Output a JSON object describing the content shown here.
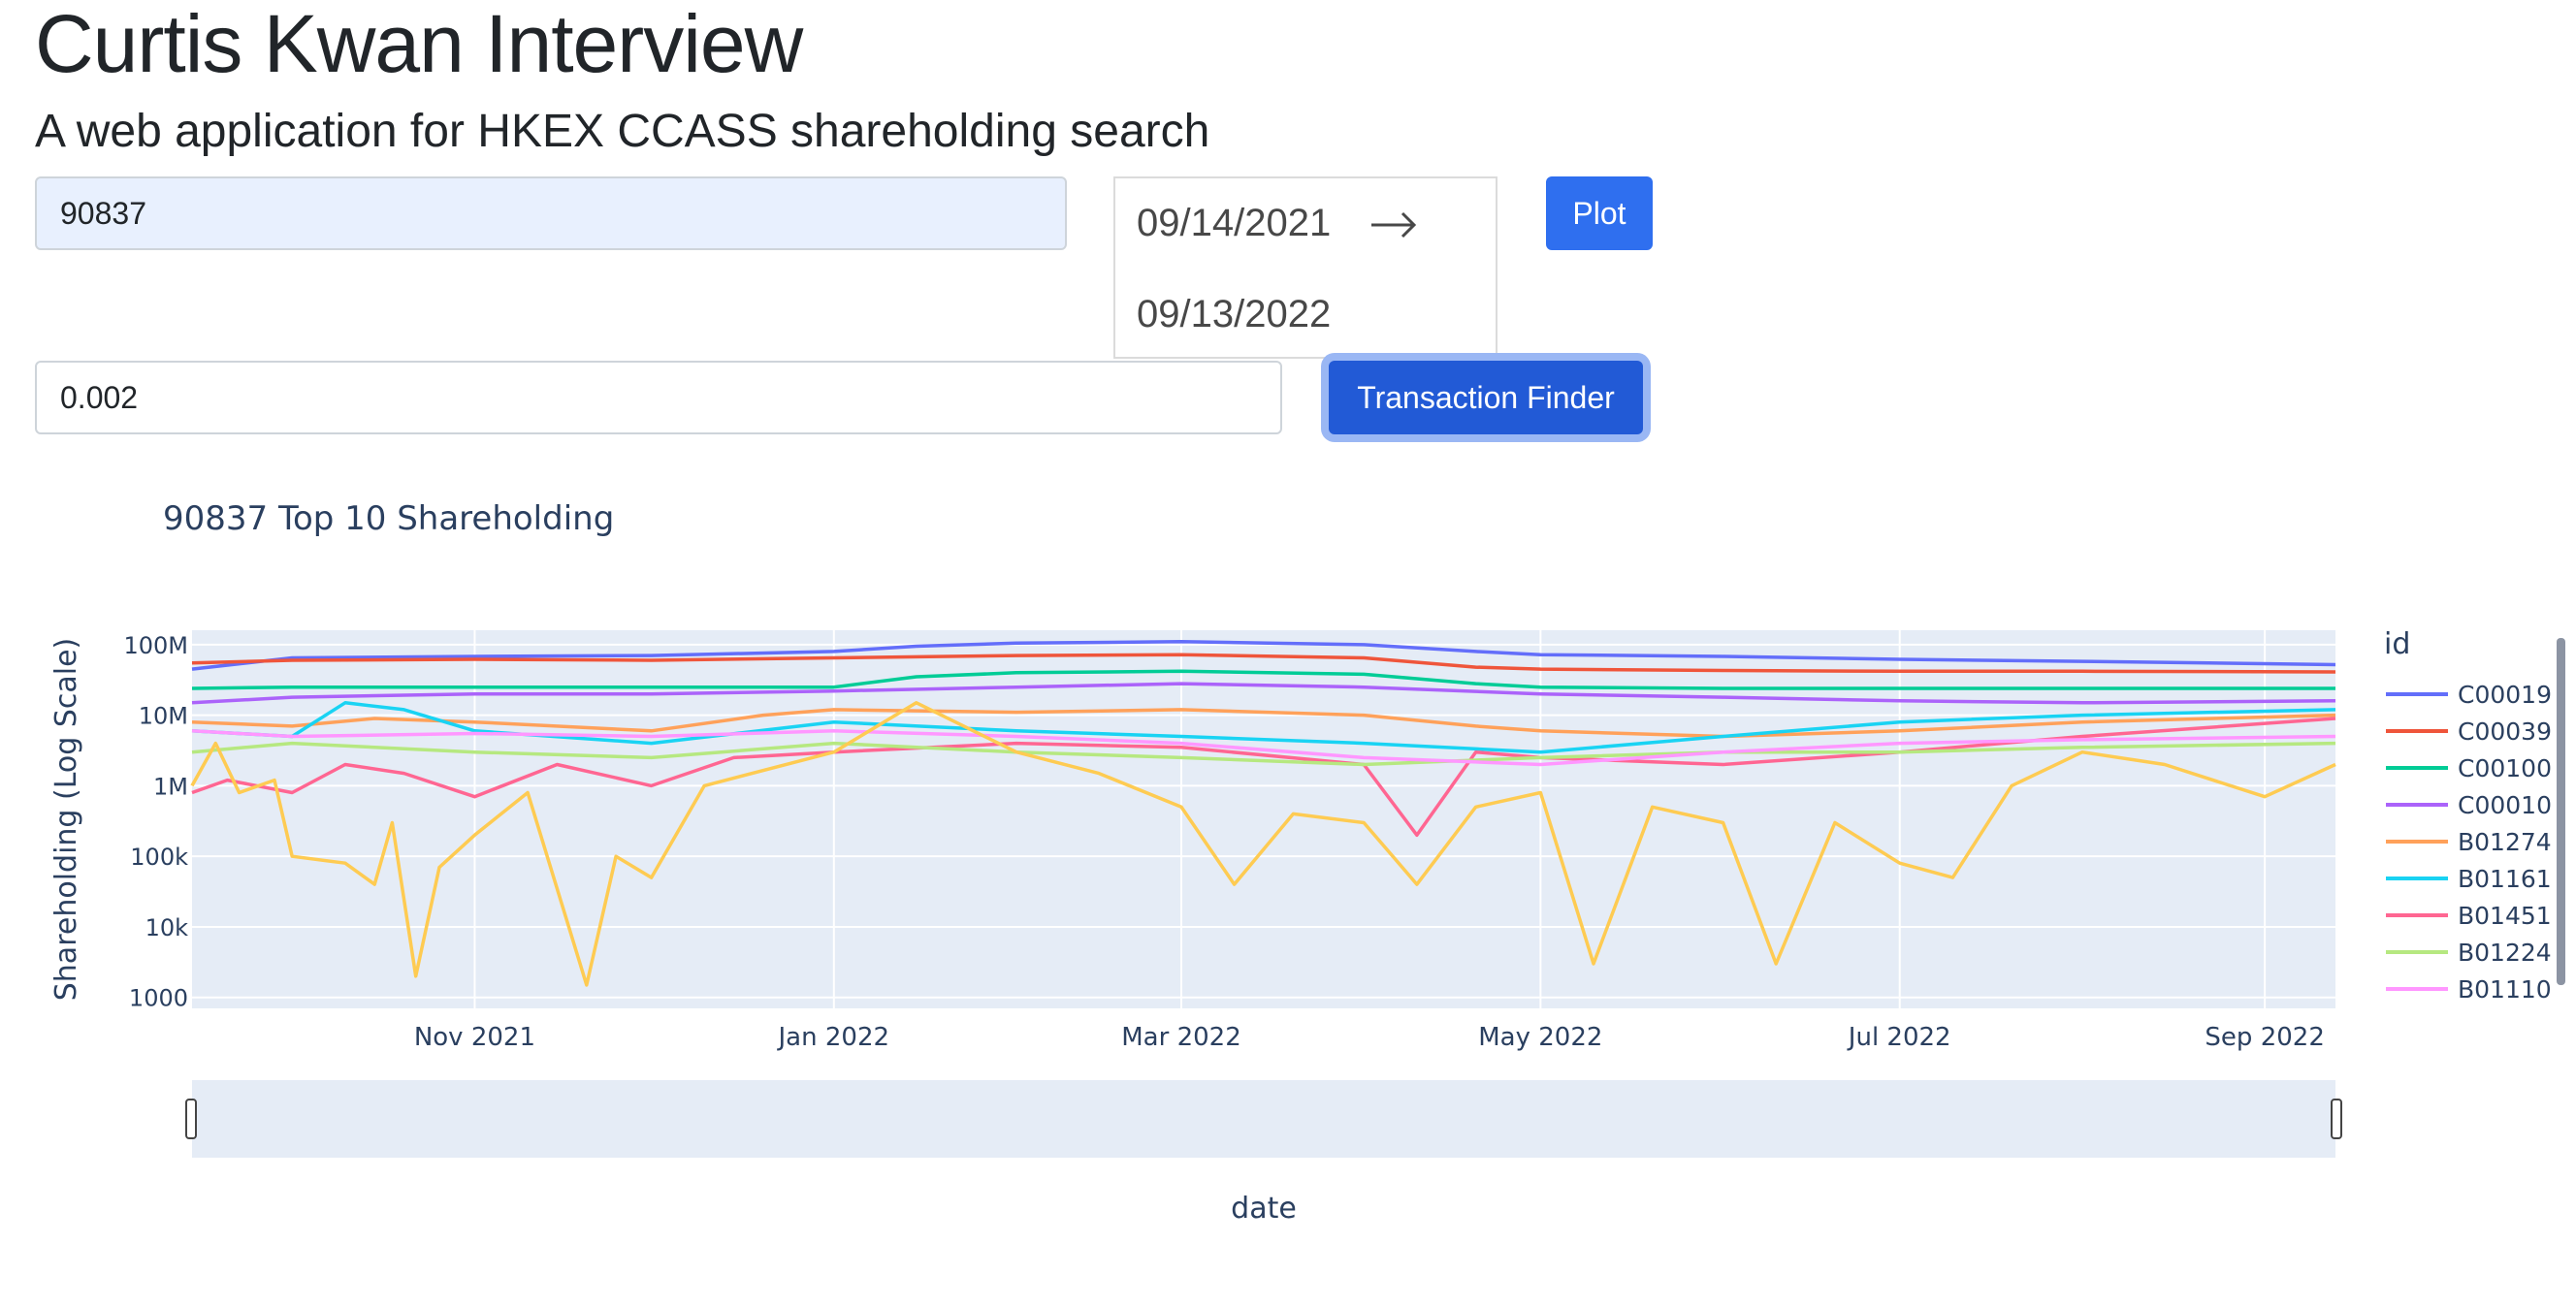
{
  "page": {
    "title": "Curtis Kwan Interview",
    "subtitle": "A web application for HKEX CCASS shareholding search"
  },
  "form": {
    "stock_code_value": "90837",
    "date_start": "09/14/2021",
    "date_end": "09/13/2022",
    "plot_label": "Plot",
    "threshold_value": "0.002",
    "finder_label": "Transaction Finder"
  },
  "icons": {
    "date_arrow": "right-arrow-icon"
  },
  "chart_data": {
    "type": "line",
    "title": "90837 Top 10 Shareholding",
    "xlabel": "date",
    "ylabel": "Shareholding (Log Scale)",
    "y_scale": "log",
    "ylim": [
      700,
      160000000
    ],
    "xlim": [
      "2021-09-14",
      "2022-09-13"
    ],
    "x_ticks": [
      "Nov 2021",
      "Jan 2022",
      "Mar 2022",
      "May 2022",
      "Jul 2022",
      "Sep 2022"
    ],
    "y_ticks": [
      "100M",
      "10M",
      "1M",
      "100k",
      "10k",
      "1000"
    ],
    "legend_title": "id",
    "legend_position": "right",
    "grid": true,
    "range_slider": true,
    "series": [
      {
        "name": "C00019",
        "color": "#636efa",
        "values": [
          [
            "2021-09-14",
            45000000
          ],
          [
            "2021-10-01",
            65000000
          ],
          [
            "2021-11-01",
            68000000
          ],
          [
            "2021-12-01",
            70000000
          ],
          [
            "2022-01-01",
            80000000
          ],
          [
            "2022-01-15",
            95000000
          ],
          [
            "2022-02-01",
            105000000
          ],
          [
            "2022-03-01",
            110000000
          ],
          [
            "2022-04-01",
            100000000
          ],
          [
            "2022-04-20",
            80000000
          ],
          [
            "2022-05-01",
            72000000
          ],
          [
            "2022-06-01",
            68000000
          ],
          [
            "2022-07-01",
            62000000
          ],
          [
            "2022-08-01",
            58000000
          ],
          [
            "2022-09-13",
            52000000
          ]
        ]
      },
      {
        "name": "C00039",
        "color": "#ef553b",
        "values": [
          [
            "2021-09-14",
            55000000
          ],
          [
            "2021-10-01",
            60000000
          ],
          [
            "2021-11-01",
            62000000
          ],
          [
            "2021-12-01",
            60000000
          ],
          [
            "2022-01-01",
            65000000
          ],
          [
            "2022-02-01",
            70000000
          ],
          [
            "2022-03-01",
            72000000
          ],
          [
            "2022-04-01",
            65000000
          ],
          [
            "2022-04-20",
            48000000
          ],
          [
            "2022-05-01",
            45000000
          ],
          [
            "2022-06-01",
            43000000
          ],
          [
            "2022-07-01",
            42000000
          ],
          [
            "2022-08-01",
            42000000
          ],
          [
            "2022-09-13",
            41000000
          ]
        ]
      },
      {
        "name": "C00100",
        "color": "#00cc96",
        "values": [
          [
            "2021-09-14",
            24000000
          ],
          [
            "2021-10-01",
            25000000
          ],
          [
            "2021-11-01",
            25000000
          ],
          [
            "2021-12-01",
            25000000
          ],
          [
            "2022-01-01",
            25000000
          ],
          [
            "2022-01-15",
            35000000
          ],
          [
            "2022-02-01",
            40000000
          ],
          [
            "2022-03-01",
            42000000
          ],
          [
            "2022-04-01",
            38000000
          ],
          [
            "2022-04-20",
            28000000
          ],
          [
            "2022-05-01",
            25000000
          ],
          [
            "2022-06-01",
            24000000
          ],
          [
            "2022-07-01",
            24000000
          ],
          [
            "2022-08-01",
            24000000
          ],
          [
            "2022-09-13",
            24000000
          ]
        ]
      },
      {
        "name": "C00010",
        "color": "#ab63fa",
        "values": [
          [
            "2021-09-14",
            15000000
          ],
          [
            "2021-10-01",
            18000000
          ],
          [
            "2021-11-01",
            20000000
          ],
          [
            "2021-12-01",
            20000000
          ],
          [
            "2022-01-01",
            22000000
          ],
          [
            "2022-02-01",
            25000000
          ],
          [
            "2022-03-01",
            28000000
          ],
          [
            "2022-04-01",
            25000000
          ],
          [
            "2022-05-01",
            20000000
          ],
          [
            "2022-06-01",
            18000000
          ],
          [
            "2022-07-01",
            16000000
          ],
          [
            "2022-08-01",
            15000000
          ],
          [
            "2022-09-13",
            16000000
          ]
        ]
      },
      {
        "name": "B01274",
        "color": "#ffa15a",
        "values": [
          [
            "2021-09-14",
            8000000
          ],
          [
            "2021-10-01",
            7000000
          ],
          [
            "2021-10-15",
            9000000
          ],
          [
            "2021-11-01",
            8000000
          ],
          [
            "2021-12-01",
            6000000
          ],
          [
            "2021-12-20",
            10000000
          ],
          [
            "2022-01-01",
            12000000
          ],
          [
            "2022-02-01",
            11000000
          ],
          [
            "2022-03-01",
            12000000
          ],
          [
            "2022-04-01",
            10000000
          ],
          [
            "2022-04-20",
            7000000
          ],
          [
            "2022-05-01",
            6000000
          ],
          [
            "2022-06-01",
            5000000
          ],
          [
            "2022-07-01",
            6000000
          ],
          [
            "2022-08-01",
            8000000
          ],
          [
            "2022-09-13",
            10000000
          ]
        ]
      },
      {
        "name": "B01161",
        "color": "#19d3f3",
        "values": [
          [
            "2021-09-14",
            6000000
          ],
          [
            "2021-10-01",
            5000000
          ],
          [
            "2021-10-10",
            15000000
          ],
          [
            "2021-10-20",
            12000000
          ],
          [
            "2021-11-01",
            6000000
          ],
          [
            "2021-12-01",
            4000000
          ],
          [
            "2022-01-01",
            8000000
          ],
          [
            "2022-02-01",
            6000000
          ],
          [
            "2022-03-01",
            5000000
          ],
          [
            "2022-04-01",
            4000000
          ],
          [
            "2022-05-01",
            3000000
          ],
          [
            "2022-06-01",
            5000000
          ],
          [
            "2022-07-01",
            8000000
          ],
          [
            "2022-08-01",
            10000000
          ],
          [
            "2022-09-13",
            12000000
          ]
        ]
      },
      {
        "name": "B01451",
        "color": "#ff6692",
        "values": [
          [
            "2021-09-14",
            800000
          ],
          [
            "2021-09-20",
            1200000
          ],
          [
            "2021-10-01",
            800000
          ],
          [
            "2021-10-10",
            2000000
          ],
          [
            "2021-10-20",
            1500000
          ],
          [
            "2021-11-01",
            700000
          ],
          [
            "2021-11-15",
            2000000
          ],
          [
            "2021-12-01",
            1000000
          ],
          [
            "2021-12-15",
            2500000
          ],
          [
            "2022-01-01",
            3000000
          ],
          [
            "2022-02-01",
            4000000
          ],
          [
            "2022-03-01",
            3500000
          ],
          [
            "2022-04-01",
            2000000
          ],
          [
            "2022-04-10",
            200000
          ],
          [
            "2022-04-20",
            3000000
          ],
          [
            "2022-05-01",
            2500000
          ],
          [
            "2022-06-01",
            2000000
          ],
          [
            "2022-07-01",
            3000000
          ],
          [
            "2022-08-01",
            5000000
          ],
          [
            "2022-09-13",
            9000000
          ]
        ]
      },
      {
        "name": "B01224",
        "color": "#b6e880",
        "values": [
          [
            "2021-09-14",
            3000000
          ],
          [
            "2021-10-01",
            4000000
          ],
          [
            "2021-11-01",
            3000000
          ],
          [
            "2021-12-01",
            2500000
          ],
          [
            "2022-01-01",
            4000000
          ],
          [
            "2022-02-01",
            3000000
          ],
          [
            "2022-03-01",
            2500000
          ],
          [
            "2022-04-01",
            2000000
          ],
          [
            "2022-05-01",
            2500000
          ],
          [
            "2022-06-01",
            3000000
          ],
          [
            "2022-07-01",
            3000000
          ],
          [
            "2022-08-01",
            3500000
          ],
          [
            "2022-09-13",
            4000000
          ]
        ]
      },
      {
        "name": "B01110",
        "color": "#ff97ff",
        "values": [
          [
            "2021-09-14",
            6000000
          ],
          [
            "2021-10-01",
            5000000
          ],
          [
            "2021-11-01",
            5500000
          ],
          [
            "2021-12-01",
            5000000
          ],
          [
            "2022-01-01",
            6000000
          ],
          [
            "2022-02-01",
            5000000
          ],
          [
            "2022-03-01",
            4000000
          ],
          [
            "2022-04-01",
            2500000
          ],
          [
            "2022-05-01",
            2000000
          ],
          [
            "2022-06-01",
            3000000
          ],
          [
            "2022-07-01",
            4000000
          ],
          [
            "2022-08-01",
            4500000
          ],
          [
            "2022-09-13",
            5000000
          ]
        ]
      },
      {
        "name": "",
        "color": "#fecb52",
        "values": [
          [
            "2021-09-14",
            1000000
          ],
          [
            "2021-09-18",
            4000000
          ],
          [
            "2021-09-22",
            800000
          ],
          [
            "2021-09-28",
            1200000
          ],
          [
            "2021-10-01",
            100000
          ],
          [
            "2021-10-10",
            80000
          ],
          [
            "2021-10-15",
            40000
          ],
          [
            "2021-10-18",
            300000
          ],
          [
            "2021-10-22",
            2000
          ],
          [
            "2021-10-26",
            70000
          ],
          [
            "2021-11-01",
            200000
          ],
          [
            "2021-11-10",
            800000
          ],
          [
            "2021-11-20",
            1500
          ],
          [
            "2021-11-25",
            100000
          ],
          [
            "2021-12-01",
            50000
          ],
          [
            "2021-12-10",
            1000000
          ],
          [
            "2022-01-01",
            3000000
          ],
          [
            "2022-01-15",
            15000000
          ],
          [
            "2022-02-01",
            3000000
          ],
          [
            "2022-02-15",
            1500000
          ],
          [
            "2022-03-01",
            500000
          ],
          [
            "2022-03-10",
            40000
          ],
          [
            "2022-03-20",
            400000
          ],
          [
            "2022-04-01",
            300000
          ],
          [
            "2022-04-10",
            40000
          ],
          [
            "2022-04-20",
            500000
          ],
          [
            "2022-05-01",
            800000
          ],
          [
            "2022-05-10",
            3000
          ],
          [
            "2022-05-20",
            500000
          ],
          [
            "2022-06-01",
            300000
          ],
          [
            "2022-06-10",
            3000
          ],
          [
            "2022-06-20",
            300000
          ],
          [
            "2022-07-01",
            80000
          ],
          [
            "2022-07-10",
            50000
          ],
          [
            "2022-07-20",
            1000000
          ],
          [
            "2022-08-01",
            3000000
          ],
          [
            "2022-08-15",
            2000000
          ],
          [
            "2022-09-01",
            700000
          ],
          [
            "2022-09-13",
            2000000
          ]
        ]
      }
    ]
  }
}
